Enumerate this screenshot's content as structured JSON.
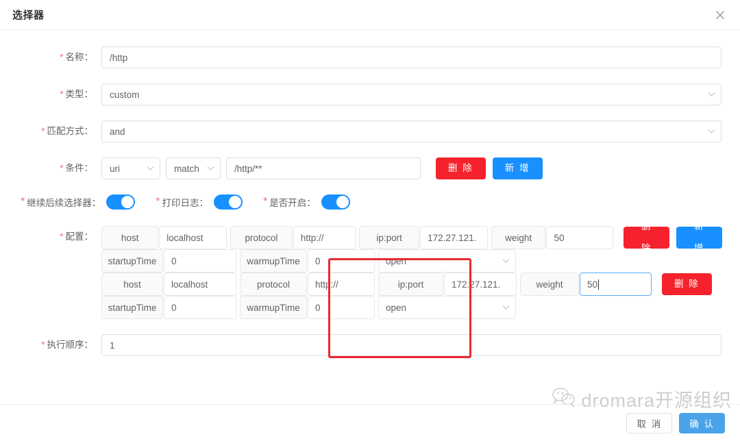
{
  "dialog": {
    "title": "选择器",
    "close_icon": "close-icon"
  },
  "form": {
    "name": {
      "label": "名称：",
      "required": true,
      "value": "/http"
    },
    "type": {
      "label": "类型：",
      "required": true,
      "value": "custom"
    },
    "match_mode": {
      "label": "匹配方式：",
      "required": true,
      "value": "and"
    },
    "condition": {
      "label": "条件：",
      "required": true,
      "field": "uri",
      "operator": "match",
      "value": "/http/**",
      "delete_label": "删 除",
      "add_label": "新 增"
    },
    "switches": [
      {
        "label": "继续后续选择器：",
        "on": true
      },
      {
        "label": "打印日志：",
        "on": true
      },
      {
        "label": "是否开启：",
        "on": true
      }
    ],
    "config": {
      "label": "配置：",
      "required": true,
      "delete_label": "删 除",
      "add_label": "新 增",
      "groups": [
        {
          "host_key": "host",
          "host_value": "localhost",
          "protocol_key": "protocol",
          "protocol_value": "http://",
          "ipport_key": "ip:port",
          "ipport_value": "172.27.121.",
          "weight_key": "weight",
          "weight_value": "50",
          "startup_key": "startupTime",
          "startup_value": "0",
          "warmup_key": "warmupTime",
          "warmup_value": "0",
          "status_value": "open",
          "weight_focused": false,
          "has_add": true
        },
        {
          "host_key": "host",
          "host_value": "localhost",
          "protocol_key": "protocol",
          "protocol_value": "http://",
          "ipport_key": "ip:port",
          "ipport_value": "172.27.121.",
          "weight_key": "weight",
          "weight_value": "50",
          "startup_key": "startupTime",
          "startup_value": "0",
          "warmup_key": "warmupTime",
          "warmup_value": "0",
          "status_value": "open",
          "weight_focused": true,
          "has_add": false
        }
      ]
    },
    "exec_order": {
      "label": "执行顺序：",
      "required": true,
      "value": "1"
    }
  },
  "highlight": {
    "color": "#e8292f"
  },
  "watermark": {
    "text": "dromara开源组织",
    "icon": "wechat-icon"
  },
  "footer": {
    "cancel_label": "取 消",
    "confirm_label": "确 认"
  }
}
